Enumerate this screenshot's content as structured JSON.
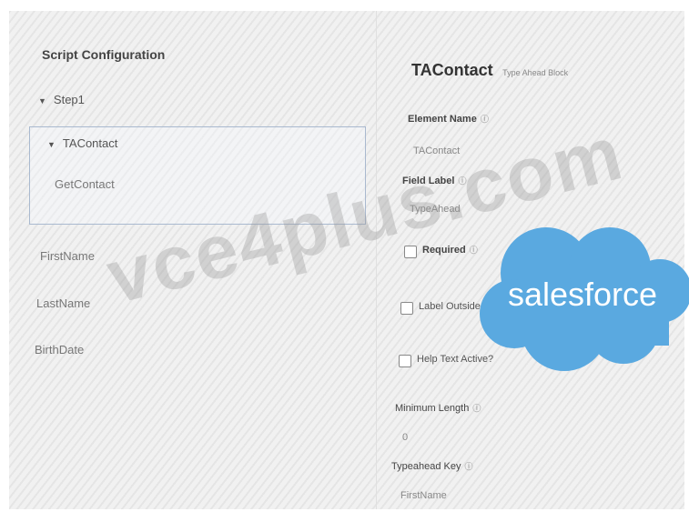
{
  "left_panel": {
    "heading": "Script Configuration",
    "step": "Step1",
    "block": "TAContact",
    "block_child": "GetContact",
    "fields": [
      "FirstName",
      "LastName",
      "BirthDate"
    ]
  },
  "properties": {
    "title": "TAContact",
    "subtype": "Type Ahead Block",
    "element_name_label": "Element Name",
    "element_name_value": "TAContact",
    "field_label_label": "Field Label",
    "field_label_value": "TypeAhead",
    "required_label": "Required",
    "label_outside_label": "Label Outside Pick",
    "help_text_label": "Help Text Active?",
    "min_length_label": "Minimum Length",
    "min_length_value": "0",
    "typeahead_key_label": "Typeahead Key",
    "typeahead_key_value": "FirstName"
  },
  "overlays": {
    "watermark": "vce4plus.com",
    "logo_text": "salesforce",
    "logo_color": "#5aa9e0"
  },
  "icons": {
    "info": "info-icon",
    "caret": "caret-down-icon"
  }
}
